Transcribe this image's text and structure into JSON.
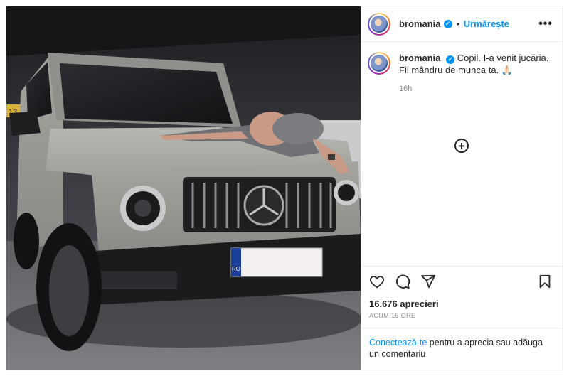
{
  "post": {
    "username": "bromania",
    "follow_label": "Urmărește",
    "separator": "•",
    "more_label": "•••",
    "caption": "Copil. I-a venit jucăria. Fii mândru de munca ta. 🙏🏻",
    "caption_time": "16h",
    "load_more_symbol": "+",
    "likes_text": "16.676 aprecieri",
    "date_text": "ACUM 16 ORE",
    "login_link": "Conectează-te",
    "login_rest": " pentru a aprecia sau adăuga un comentariu",
    "plate_country": "RO",
    "parking_number": "13"
  },
  "icons": {
    "verified": "verified-badge-icon",
    "like": "heart-icon",
    "comment": "comment-icon",
    "share": "paper-plane-icon",
    "save": "bookmark-icon"
  },
  "colors": {
    "accent": "#0095f6",
    "text": "#262626",
    "muted": "#8e8e8e",
    "border": "#dbdbdb"
  }
}
